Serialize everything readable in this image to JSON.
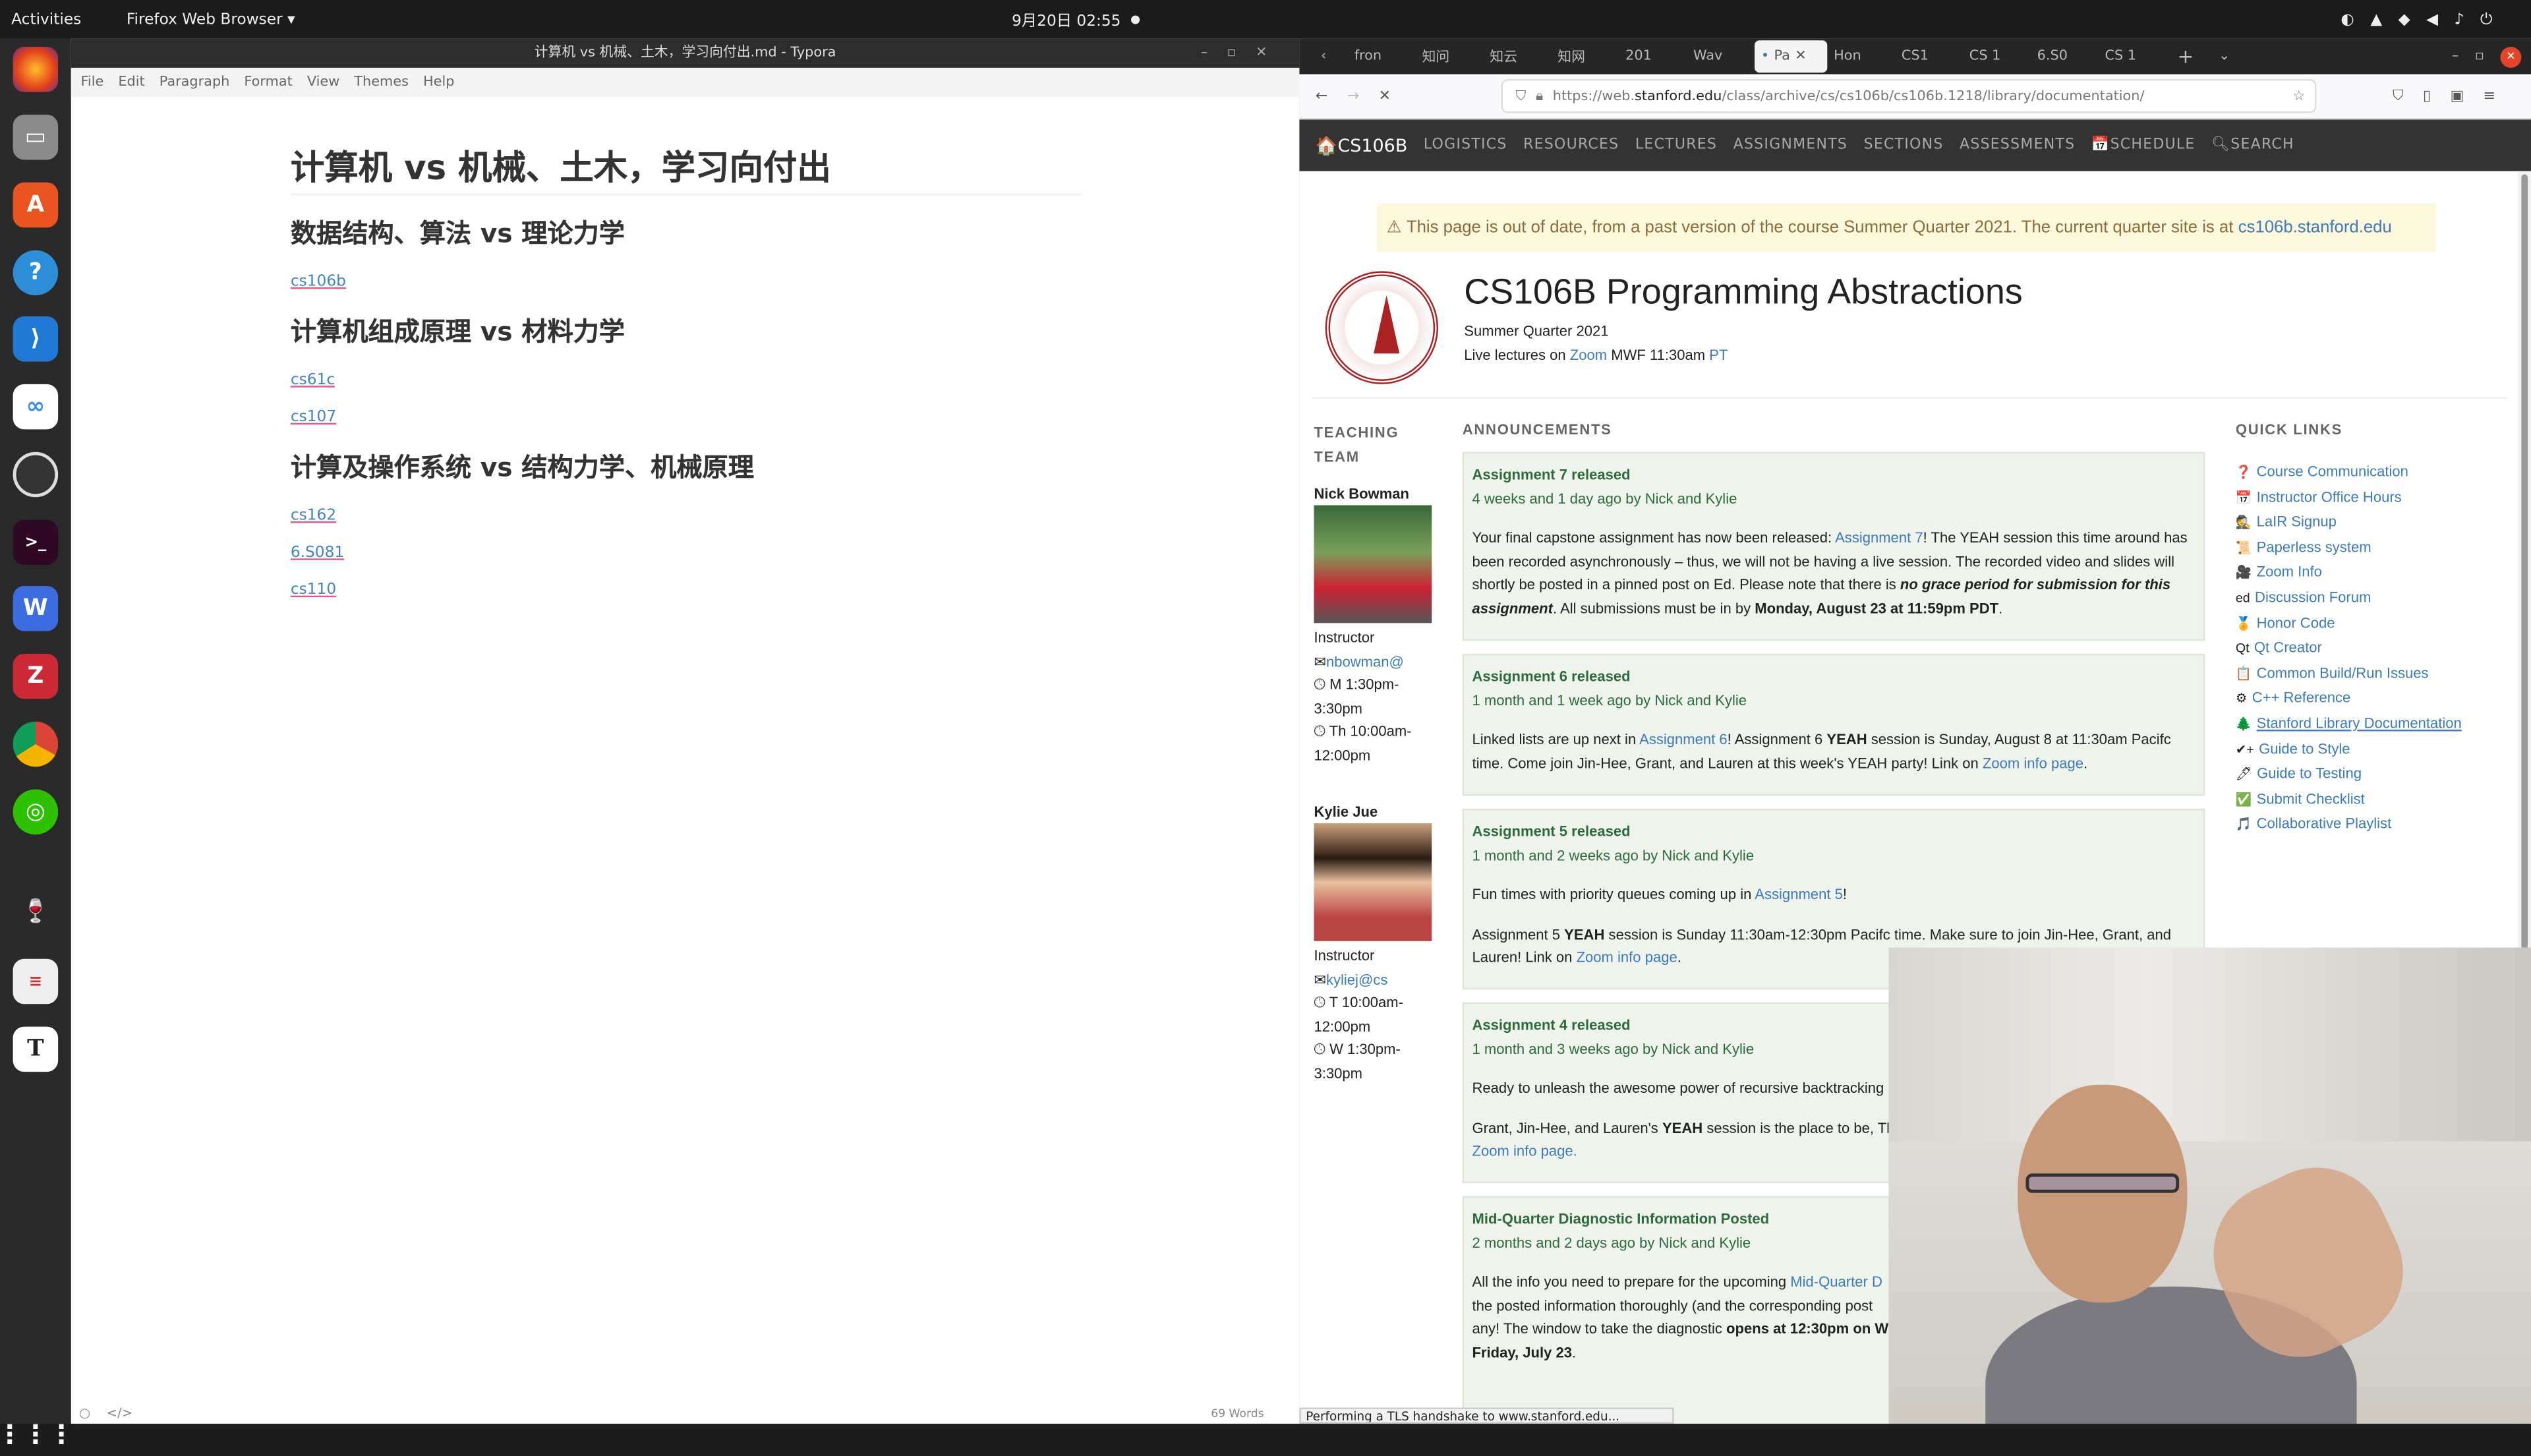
{
  "topbar": {
    "activities": "Activities",
    "app": "Firefox Web Browser ▾",
    "clock": "9月20日 02:55",
    "dot": "●"
  },
  "dock": {
    "items": [
      "firefox",
      "files",
      "app-center",
      "help",
      "vscode",
      "baidu-netdisk",
      "obs",
      "terminal",
      "wps",
      "zotero",
      "chrome",
      "wechat",
      "wine",
      "reader",
      "typora",
      "show-apps"
    ]
  },
  "typora": {
    "title": "计算机 vs 机械、土木，学习向付出.md - Typora",
    "menu": [
      "File",
      "Edit",
      "Paragraph",
      "Format",
      "View",
      "Themes",
      "Help"
    ],
    "h1": "计算机 vs 机械、土木，学习向付出",
    "sections": [
      {
        "heading": "数据结构、算法 vs 理论力学",
        "links": [
          "cs106b"
        ]
      },
      {
        "heading": "计算机组成原理 vs 材料力学",
        "links": [
          "cs61c",
          "cs107"
        ]
      },
      {
        "heading": "计算及操作系统 vs 结构力学、机械原理",
        "links": [
          "cs162",
          "6.S081",
          "cs110"
        ]
      }
    ],
    "word_count": "69 Words"
  },
  "firefox": {
    "tabs": [
      "fron",
      "知问",
      "知云",
      "知网",
      "201",
      "Wav",
      "Pa",
      "Hon",
      "CS1",
      "CS 1",
      "6.S0",
      "CS 1"
    ],
    "active_tab": 6,
    "url_prefix": "https://web.",
    "url_domain": "stanford.edu",
    "url_path": "/class/archive/cs/cs106b/cs106b.1218/library/documentation/",
    "status": "Performing a TLS handshake to www.stanford.edu..."
  },
  "site": {
    "brand": "CS106B",
    "nav": [
      "LOGISTICS",
      "RESOURCES",
      "LECTURES",
      "ASSIGNMENTS",
      "SECTIONS",
      "ASSESSMENTS",
      "SCHEDULE",
      "SEARCH"
    ],
    "warning": "This page is out of date, from a past version of the course Summer Quarter 2021. The current quarter site is at ",
    "warning_link": "cs106b.stanford.edu",
    "title": "CS106B Programming Abstractions",
    "quarter": "Summer Quarter 2021",
    "live_pre": "Live lectures on ",
    "live_zoom": "Zoom",
    "live_time": " MWF 11:30am ",
    "live_pt": "PT",
    "team_heading": "TEACHING TEAM",
    "team": [
      {
        "name": "Nick Bowman",
        "role": "Instructor",
        "email": "nbowman@",
        "hours": [
          "M 1:30pm-3:30pm",
          "Th 10:00am-12:00pm"
        ]
      },
      {
        "name": "Kylie Jue",
        "role": "Instructor",
        "email": "kyliej@cs",
        "hours": [
          "T 10:00am-12:00pm",
          "W 1:30pm-3:30pm"
        ]
      }
    ],
    "ann_heading": "ANNOUNCEMENTS",
    "announcements": [
      {
        "title": "Assignment 7 released",
        "meta": "4 weeks and 1 day ago by Nick and Kylie",
        "body": [
          "Your final capstone assignment has now been released: ",
          "Assignment 7",
          "! The YEAH session this time around has been recorded asynchronously – thus, we will not be having a live session. The recorded video and slides will shortly be posted in a pinned post on Ed. Please note that there is ",
          "no grace period for submission for this assignment",
          ". All submissions must be in by ",
          "Monday, August 23 at 11:59pm PDT",
          "."
        ]
      },
      {
        "title": "Assignment 6 released",
        "meta": "1 month and 1 week ago by Nick and Kylie",
        "body": [
          "Linked lists are up next in ",
          "Assignment 6",
          "! Assignment 6 ",
          "YEAH",
          " session is Sunday, August 8 at 11:30am Pacifc time. Come join Jin-Hee, Grant, and Lauren at this week's YEAH party! Link on ",
          "Zoom info page",
          "."
        ]
      },
      {
        "title": "Assignment 5 released",
        "meta": "1 month and 2 weeks ago by Nick and Kylie",
        "p1": [
          "Fun times with priority queues coming up in ",
          "Assignment 5",
          "!"
        ],
        "p2": [
          "Assignment 5 ",
          "YEAH",
          " session is Sunday 11:30am-12:30pm Pacifc time. Make sure to join Jin-Hee, Grant, and Lauren! Link on ",
          "Zoom info page",
          "."
        ]
      },
      {
        "title": "Assignment 4 released",
        "meta": "1 month and 3 weeks ago by Nick and Kylie",
        "p1": "Ready to unleash the awesome power of recursive backtracking",
        "p2": [
          "Grant, Jin-Hee, and Lauren's ",
          "YEAH",
          " session is the place to be, Th"
        ],
        "p3": "Zoom info page."
      },
      {
        "title": "Mid-Quarter Diagnostic Information Posted",
        "meta": "2 months and 2 days ago by Nick and Kylie",
        "body": [
          "All the info you need to prepare for the upcoming ",
          "Mid-Quarter D",
          "the posted information thoroughly (and the corresponding post",
          "any! The window to take the diagnostic ",
          "opens at 12:30pm on W",
          "Friday, July 23",
          "."
        ]
      }
    ],
    "ql_heading": "QUICK LINKS",
    "quick_links": [
      {
        "icon": "❓",
        "label": "Course Communication"
      },
      {
        "icon": "📅",
        "label": "Instructor Office Hours"
      },
      {
        "icon": "🕵",
        "label": "LaIR Signup"
      },
      {
        "icon": "📜",
        "label": "Paperless system"
      },
      {
        "icon": "🎥",
        "label": "Zoom Info"
      },
      {
        "icon": "ed",
        "label": "Discussion Forum"
      },
      {
        "icon": "🏅",
        "label": "Honor Code"
      },
      {
        "icon": "Qt",
        "label": "Qt Creator"
      },
      {
        "icon": "📋",
        "label": "Common Build/Run Issues"
      },
      {
        "icon": "⚙",
        "label": "C++ Reference"
      },
      {
        "icon": "🌲",
        "label": "Stanford Library Documentation"
      },
      {
        "icon": "✔+",
        "label": "Guide to Style"
      },
      {
        "icon": "🖊",
        "label": "Guide to Testing"
      },
      {
        "icon": "✅",
        "label": "Submit Checklist"
      },
      {
        "icon": "🎵",
        "label": "Collaborative Playlist"
      }
    ]
  }
}
